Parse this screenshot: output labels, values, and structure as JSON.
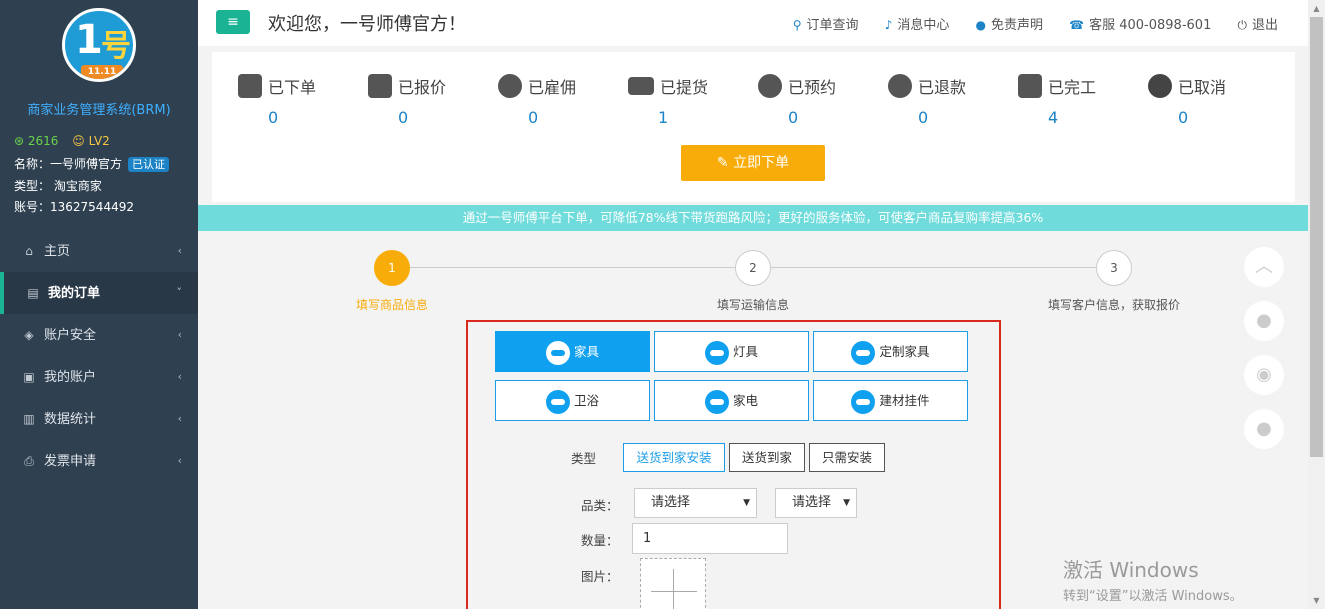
{
  "sidebar": {
    "logo_text_1": "1",
    "logo_text_2": "号",
    "logo_badge": "11.11",
    "system_title": "商家业务管理系统(BRM)",
    "points": "2616",
    "level": "LV2",
    "name_line": "名称：一号师傅官方",
    "verified": "已认证",
    "type_line": "类型： 淘宝商家",
    "account_line": "账号：13627544492",
    "items": [
      {
        "label": "主页",
        "icon": "home-icon"
      },
      {
        "label": "我的订单",
        "icon": "order-icon"
      },
      {
        "label": "账户安全",
        "icon": "shield-icon"
      },
      {
        "label": "我的账户",
        "icon": "wallet-icon"
      },
      {
        "label": "数据统计",
        "icon": "chart-icon"
      },
      {
        "label": "发票申请",
        "icon": "printer-icon"
      }
    ]
  },
  "header": {
    "menu_icon": "≡",
    "welcome": "欢迎您，一号师傅官方！",
    "links": [
      {
        "label": "订单查询",
        "icon": "search-icon"
      },
      {
        "label": "消息中心",
        "icon": "bell-icon"
      },
      {
        "label": "免责声明",
        "icon": "chat-icon"
      },
      {
        "label": "客服 400-0898-601",
        "icon": "phone-icon"
      },
      {
        "label": "退出",
        "icon": "power-icon"
      }
    ]
  },
  "status": [
    {
      "label": "已下单",
      "value": "0"
    },
    {
      "label": "已报价",
      "value": "0"
    },
    {
      "label": "已雇佣",
      "value": "0"
    },
    {
      "label": "已提货",
      "value": "1"
    },
    {
      "label": "已预约",
      "value": "0"
    },
    {
      "label": "已退款",
      "value": "0"
    },
    {
      "label": "已完工",
      "value": "4"
    },
    {
      "label": "已取消",
      "value": "0"
    }
  ],
  "order_button": "✎ 立即下单",
  "banner": "通过一号师傅平台下单，可降低78%线下带货跑路风险；更好的服务体验，可使客户商品复购率提高36%",
  "steps": [
    {
      "num": "1",
      "label": "填写商品信息"
    },
    {
      "num": "2",
      "label": "填写运输信息"
    },
    {
      "num": "3",
      "label": "填写客户信息，获取报价"
    }
  ],
  "form": {
    "categories": [
      "家具",
      "灯具",
      "定制家具",
      "卫浴",
      "家电",
      "建材挂件"
    ],
    "type_label": "类型",
    "types": [
      "送货到家安装",
      "送货到家",
      "只需安装"
    ],
    "category_label": "品类：",
    "select1": "请选择",
    "select2": "请选择",
    "qty_label": "数量：",
    "qty_value": "1",
    "image_label": "图片："
  },
  "watermark": {
    "line1": "激活 Windows",
    "line2": "转到“设置”以激活 Windows。"
  }
}
